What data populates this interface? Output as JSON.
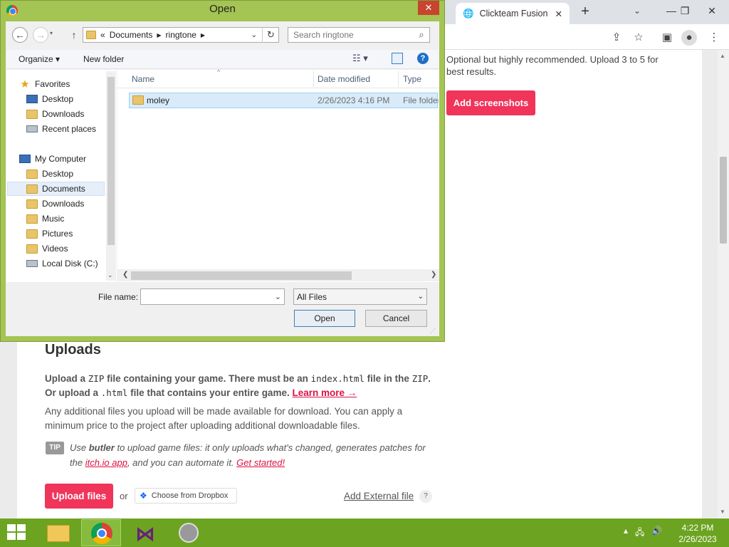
{
  "browser": {
    "tab_title": "Clickteam Fusion",
    "tab_close": "✕",
    "new_tab": "+",
    "tab_search": "⌄",
    "min": "—",
    "restore": "❐",
    "close": "✕"
  },
  "page": {
    "screenshots_desc": "Optional but highly recommended. Upload 3 to 5 for best results.",
    "add_screenshots": "Add screenshots",
    "uploads_heading": "Uploads",
    "up_p1_a": "Upload a ",
    "up_p1_zip": "ZIP",
    "up_p1_b": " file containing your game. There must be an ",
    "up_p1_index": "index.html",
    "up_p1_c": " file in the ",
    "up_p1_zip2": "ZIP",
    "up_p1_d": ". Or upload a ",
    "up_p1_html": ".html",
    "up_p1_e": " file that contains your entire game. ",
    "learn_more": "Learn more →",
    "up_p2": "Any additional files you upload will be made available for download. You can apply a minimum price to the project after uploading additional downloadable files.",
    "tip_badge": "TIP",
    "tip_a": "Use ",
    "tip_butler": "butler",
    "tip_b": " to upload game files: it only uploads what's changed, generates patches for the ",
    "tip_itch": "itch.io app",
    "tip_c": ", and you can automate it. ",
    "tip_started": "Get started!",
    "upload_files": "Upload files",
    "or": "or",
    "dropbox": "Choose from Dropbox",
    "external_file": "Add External file",
    "help": "?"
  },
  "dialog": {
    "title": "Open",
    "close": "✕",
    "breadcrumb_sep": "«",
    "crumb1": "Documents",
    "crumb2": "ringtone",
    "search_placeholder": "Search ringtone",
    "organize": "Organize ▾",
    "new_folder": "New folder",
    "favorites": "Favorites",
    "fav_items": [
      "Desktop",
      "Downloads",
      "Recent places"
    ],
    "my_computer": "My Computer",
    "pc_items": [
      "Desktop",
      "Documents",
      "Downloads",
      "Music",
      "Pictures",
      "Videos",
      "Local Disk (C:)"
    ],
    "columns": {
      "name": "Name",
      "date": "Date modified",
      "type": "Type"
    },
    "rows": [
      {
        "name": "moley",
        "date": "2/26/2023 4:16 PM",
        "type": "File folder"
      }
    ],
    "file_name_label": "File name:",
    "file_name_value": "",
    "filter": "All Files",
    "open": "Open",
    "cancel": "Cancel"
  },
  "taskbar": {
    "time": "4:22 PM",
    "date": "2/26/2023"
  }
}
